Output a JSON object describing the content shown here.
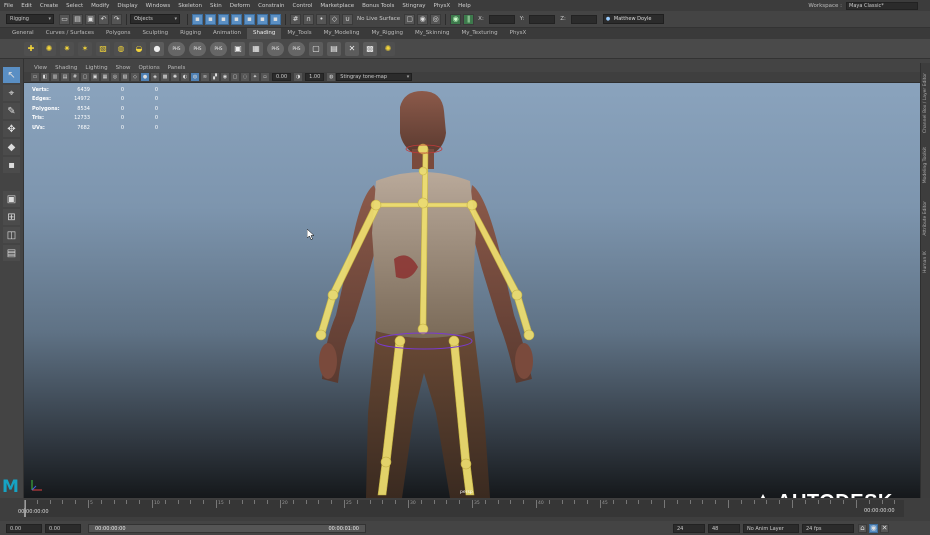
{
  "menubar": {
    "items": [
      "File",
      "Edit",
      "Create",
      "Select",
      "Modify",
      "Display",
      "Windows",
      "Skeleton",
      "Skin",
      "Deform",
      "Constrain",
      "Control",
      "Marketplace",
      "Bonus Tools",
      "Stingray",
      "PhysX",
      "Help"
    ],
    "workspace_label": "Workspace :",
    "workspace_value": "Maya Classic*"
  },
  "statusline": {
    "mode": "Rigging",
    "selection_mode": "Objects",
    "live_surface": "No Live Surface",
    "x_label": "X:",
    "y_label": "Y:",
    "z_label": "Z:",
    "user": "Matthew Doyle"
  },
  "shelf_tabs": {
    "items": [
      "General",
      "Curves / Surfaces",
      "Polygons",
      "Sculpting",
      "Rigging",
      "Animation",
      "Shading",
      "My_Tools",
      "My_Modeling",
      "My_Rigging",
      "My_Skinning",
      "My_Texturing",
      "PhysX"
    ],
    "active": "Shading"
  },
  "shelf_icons": {
    "first_pills": [
      "PHS",
      "PHS",
      "PHS"
    ],
    "second_pills": [
      "PHS",
      "PHS"
    ]
  },
  "panel": {
    "menu": [
      "View",
      "Shading",
      "Lighting",
      "Show",
      "Options",
      "Panels"
    ],
    "field_a": "0.00",
    "field_b": "1.00",
    "tonemap": "Stingray tone-map"
  },
  "hud": {
    "rows": [
      {
        "label": "Verts:",
        "value": "6439",
        "sel1": "0",
        "sel2": "0"
      },
      {
        "label": "Edges:",
        "value": "14972",
        "sel1": "0",
        "sel2": "0"
      },
      {
        "label": "Polygons:",
        "value": "8534",
        "sel1": "0",
        "sel2": "0"
      },
      {
        "label": "Tris:",
        "value": "12733",
        "sel1": "0",
        "sel2": "0"
      },
      {
        "label": "UVs:",
        "value": "7682",
        "sel1": "0",
        "sel2": "0"
      }
    ]
  },
  "viewport": {
    "camera_label": "persp"
  },
  "right_tabs": [
    "Channel Box / Layer Editor",
    "Modeling Toolkit",
    "Attribute Editor",
    "Human IK"
  ],
  "timeslider": {
    "tick_labels": [
      "5",
      "10",
      "15",
      "20",
      "25",
      "30",
      "35",
      "40",
      "45"
    ],
    "current_tc": "00:00:00:00",
    "right_tc": "00:00:00:00"
  },
  "range": {
    "start": "0.00",
    "anim_start": "0.00",
    "range_start": "00:00:00:00",
    "range_end": "00:00:01:00",
    "end": "24",
    "anim_end": "48",
    "anim_layer": "No Anim Layer",
    "fps": "24 fps"
  },
  "branding": {
    "autodesk": "AUTODESK",
    "maya_mark": "M"
  },
  "colors": {
    "accent": "#5a8fc4",
    "joint": "#f0e070",
    "maya_logo": "#16a3c3"
  }
}
